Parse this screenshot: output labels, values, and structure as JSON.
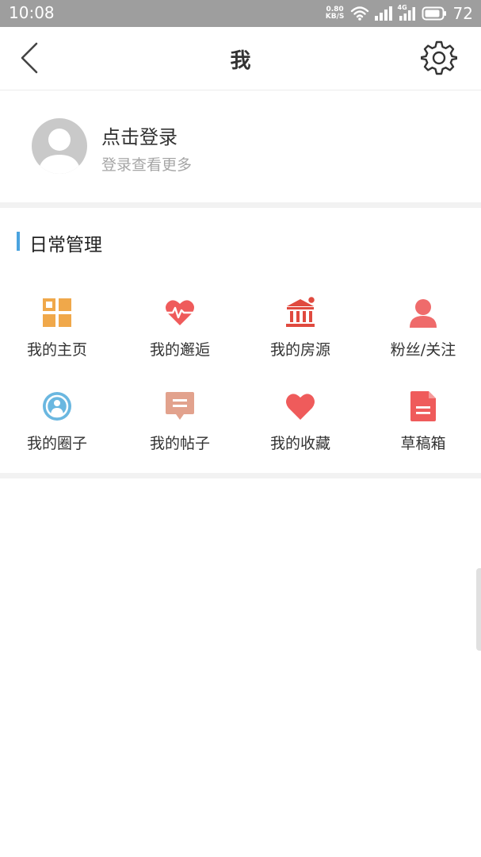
{
  "status_bar": {
    "time": "10:08",
    "net_speed_value": "0.80",
    "net_speed_unit": "KB/S",
    "network_type": "4G",
    "battery": "72"
  },
  "header": {
    "title": "我"
  },
  "profile": {
    "login_title": "点击登录",
    "login_subtitle": "登录查看更多"
  },
  "section": {
    "title": "日常管理",
    "accent_color": "#4aa3df",
    "items": [
      {
        "label": "我的主页",
        "icon": "grid-icon",
        "color": "#f0a84a"
      },
      {
        "label": "我的邂逅",
        "icon": "heartbeat-icon",
        "color": "#ef5b5b"
      },
      {
        "label": "我的房源",
        "icon": "building-icon",
        "color": "#e04a3f"
      },
      {
        "label": "粉丝/关注",
        "icon": "person-icon",
        "color": "#ef6b6b"
      },
      {
        "label": "我的圈子",
        "icon": "broadcast-icon",
        "color": "#6ab7e0"
      },
      {
        "label": "我的帖子",
        "icon": "comment-icon",
        "color": "#e2a28d"
      },
      {
        "label": "我的收藏",
        "icon": "heart-icon",
        "color": "#ef5b5b"
      },
      {
        "label": "草稿箱",
        "icon": "document-icon",
        "color": "#ef5b5b"
      }
    ]
  }
}
